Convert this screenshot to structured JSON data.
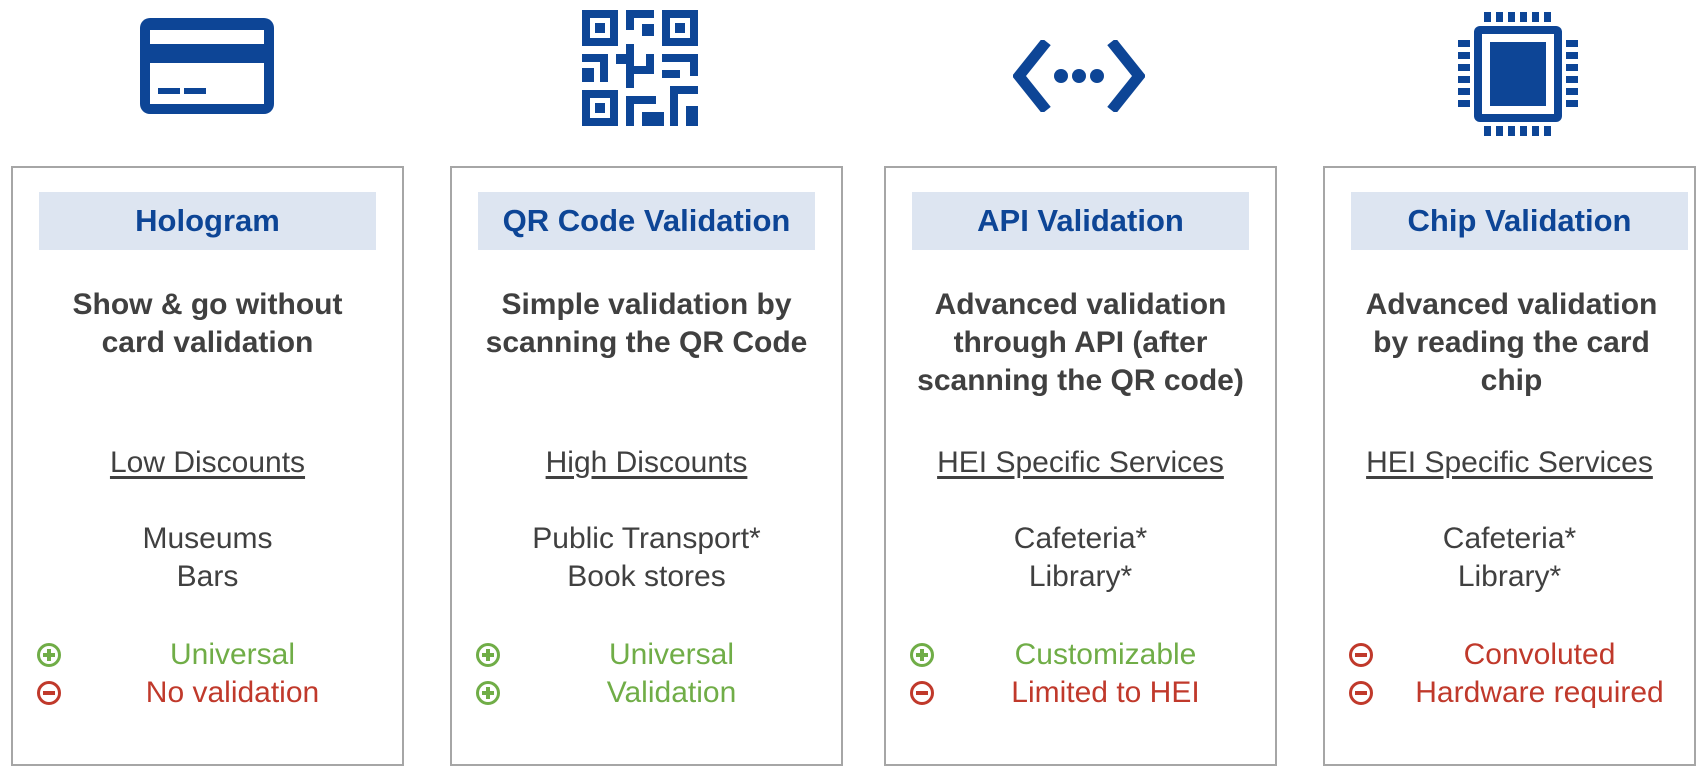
{
  "colors": {
    "brand_blue": "#0d4596",
    "title_bg": "#dde5f1",
    "pro_green": "#70ad47",
    "con_red": "#c0392b",
    "text_gray": "#404040",
    "border_gray": "#a6a6a6"
  },
  "cards": [
    {
      "icon": "credit-card-icon",
      "title": "Hologram",
      "description": [
        "Show & go without",
        "card validation"
      ],
      "category": "Low Discounts",
      "examples": [
        "Museums",
        "Bars"
      ],
      "items": [
        {
          "type": "pro",
          "text": "Universal"
        },
        {
          "type": "con",
          "text": "No validation"
        }
      ]
    },
    {
      "icon": "qr-code-icon",
      "title": "QR Code Validation",
      "description": [
        "Simple validation by",
        "scanning the QR Code"
      ],
      "category": "High Discounts",
      "examples": [
        "Public Transport*",
        "Book stores"
      ],
      "items": [
        {
          "type": "pro",
          "text": "Universal"
        },
        {
          "type": "pro",
          "text": "Validation"
        }
      ]
    },
    {
      "icon": "api-code-icon",
      "title": "API Validation",
      "description": [
        "Advanced validation",
        "through API (after",
        "scanning the QR code)"
      ],
      "category": "HEI Specific Services",
      "examples": [
        "Cafeteria*",
        "Library*"
      ],
      "items": [
        {
          "type": "pro",
          "text": "Customizable"
        },
        {
          "type": "con",
          "text": "Limited to HEI"
        }
      ]
    },
    {
      "icon": "chip-icon",
      "title": "Chip Validation",
      "description": [
        "Advanced validation",
        "by reading the card",
        "chip"
      ],
      "category": "HEI Specific Services",
      "examples": [
        "Cafeteria*",
        "Library*"
      ],
      "items": [
        {
          "type": "con",
          "text": "Convoluted"
        },
        {
          "type": "con",
          "text": "Hardware required"
        }
      ]
    }
  ]
}
